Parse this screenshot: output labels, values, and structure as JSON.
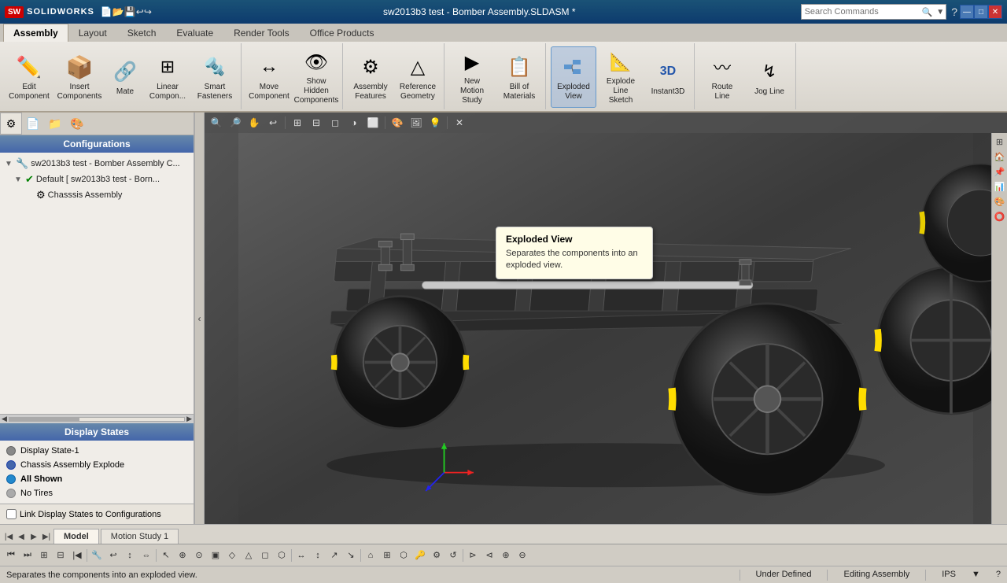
{
  "titlebar": {
    "title": "sw2013b3 test - Bomber Assembly.SLDASM *",
    "logo_sw": "SW",
    "logo_text": "SOLIDWORKS",
    "search_placeholder": "Search Commands",
    "win_minimize": "—",
    "win_maximize": "□",
    "win_close": "✕"
  },
  "ribbon": {
    "tabs": [
      {
        "label": "Assembly",
        "active": true
      },
      {
        "label": "Layout",
        "active": false
      },
      {
        "label": "Sketch",
        "active": false
      },
      {
        "label": "Evaluate",
        "active": false
      },
      {
        "label": "Render Tools",
        "active": false
      },
      {
        "label": "Office Products",
        "active": false
      }
    ],
    "buttons": [
      {
        "id": "edit-component",
        "label": "Edit\nComponent",
        "icon": "✏️"
      },
      {
        "id": "insert-components",
        "label": "Insert\nComponents",
        "icon": "📦"
      },
      {
        "id": "mate",
        "label": "Mate",
        "icon": "🔗"
      },
      {
        "id": "linear-component",
        "label": "Linear\nCompon...",
        "icon": "⊞"
      },
      {
        "id": "smart-fasteners",
        "label": "Smart\nFasteners",
        "icon": "🔩"
      },
      {
        "id": "move-component",
        "label": "Move\nComponent",
        "icon": "↔"
      },
      {
        "id": "show-hidden",
        "label": "Show\nHidden\nComponents",
        "icon": "👁"
      },
      {
        "id": "assembly-features",
        "label": "Assembly\nFeatures",
        "icon": "⚙"
      },
      {
        "id": "reference-geometry",
        "label": "Reference\nGeometry",
        "icon": "△"
      },
      {
        "id": "new-motion-study",
        "label": "New Motion\nStudy",
        "icon": "▶"
      },
      {
        "id": "bill-of-materials",
        "label": "Bill of\nMaterials",
        "icon": "📋"
      },
      {
        "id": "exploded-view",
        "label": "Exploded\nView",
        "icon": "💥",
        "active": true
      },
      {
        "id": "explode-line",
        "label": "Explode\nLine\nSketch",
        "icon": "📐"
      },
      {
        "id": "instant3d",
        "label": "Instant3D",
        "icon": "3D"
      },
      {
        "id": "route-line",
        "label": "Route\nLine",
        "icon": "〰"
      },
      {
        "id": "jog-line",
        "label": "Jog Line",
        "icon": "↯"
      }
    ]
  },
  "left_panel": {
    "panel_tabs": [
      "🔧",
      "📄",
      "📁",
      "🎨"
    ],
    "configurations_header": "Configurations",
    "tree": [
      {
        "level": 0,
        "text": "sw2013b3 test - Bomber Assembly C...",
        "icon": "🔧",
        "expander": "▼"
      },
      {
        "level": 1,
        "text": "Default [ sw2013b3 test - Born...",
        "icon": "✔",
        "expander": "▼"
      },
      {
        "level": 2,
        "text": "Chasssis Assembly",
        "icon": "⚙",
        "expander": ""
      }
    ],
    "display_states_header": "Display States",
    "display_states": [
      {
        "label": "Display State-1",
        "color": "#888888",
        "active": false
      },
      {
        "label": "Chassis Assembly Explode",
        "color": "#4466aa",
        "active": false
      },
      {
        "label": "All Shown",
        "color": "#2288cc",
        "active": true
      },
      {
        "label": "No Tires",
        "color": "#888888",
        "active": false
      }
    ],
    "link_label": "Link Display States to Configurations"
  },
  "tooltip": {
    "title": "Exploded View",
    "body": "Separates the components into an exploded view."
  },
  "bottom_tabs": {
    "model_tab": "Model",
    "motion_tab": "Motion Study 1"
  },
  "statusbar": {
    "left": "Separates the components into an exploded view.",
    "middle": "Under Defined",
    "right": "Editing Assembly",
    "units": "IPS"
  },
  "viewport_toolbar": {
    "buttons": [
      "🔍",
      "🔎",
      "✋",
      "↩",
      "⊞",
      "⊟",
      "◻",
      "◑",
      "⬜",
      "🎨",
      "🖼"
    ]
  }
}
